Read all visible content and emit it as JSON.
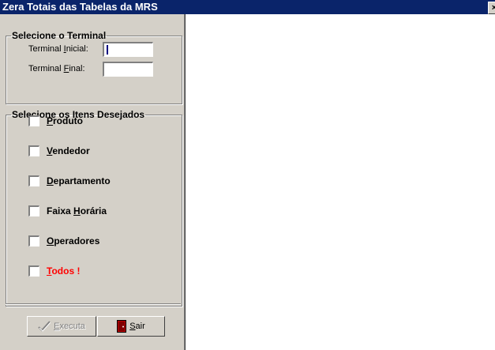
{
  "window": {
    "title": "Zera Totais das Tabelas da MRS",
    "close_glyph": "×"
  },
  "terminal_group": {
    "legend": "Selecione o Terminal",
    "initial_label": {
      "pre": "Terminal ",
      "key": "I",
      "post": "nicial:"
    },
    "final_label": {
      "pre": "Terminal ",
      "key": "F",
      "post": "inal:"
    },
    "initial_value": "",
    "final_value": ""
  },
  "items_group": {
    "legend": "Selecione os Itens Desejados",
    "items": [
      {
        "pre": "",
        "key": "P",
        "post": "roduto",
        "checked": false
      },
      {
        "pre": "",
        "key": "V",
        "post": "endedor",
        "checked": false
      },
      {
        "pre": "",
        "key": "D",
        "post": "epartamento",
        "checked": false
      },
      {
        "pre": "Faixa ",
        "key": "H",
        "post": "orária",
        "checked": false
      },
      {
        "pre": "",
        "key": "O",
        "post": "peradores",
        "checked": false
      },
      {
        "pre": "",
        "key": "T",
        "post": "odos !",
        "checked": false
      }
    ]
  },
  "buttons": {
    "execute": {
      "pre": "",
      "key": "E",
      "post": "xecuta",
      "enabled": false
    },
    "exit": {
      "pre": "",
      "key": "S",
      "post": "air",
      "enabled": true
    }
  },
  "colors": {
    "titlebar": "#0a246a",
    "panel": "#d4d0c8",
    "todos_label": "#ff0000",
    "exit_icon": "#c00000"
  },
  "icons": {
    "execute": "checkmark-icon",
    "exit": "door-exit-icon"
  }
}
